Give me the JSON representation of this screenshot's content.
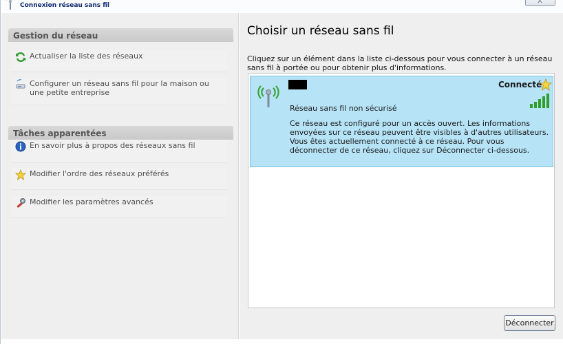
{
  "window": {
    "title": "Connexion réseau sans fil",
    "close_label": "X"
  },
  "sidebar": {
    "sections": [
      {
        "title": "Gestion du réseau",
        "items": [
          {
            "label": "Actualiser la liste des réseaux",
            "icon": "refresh-icon"
          },
          {
            "label": "Configurer un réseau sans fil pour la maison ou une petite entreprise",
            "icon": "setup-network-icon"
          }
        ]
      },
      {
        "title": "Tâches apparentées",
        "items": [
          {
            "label": "En savoir plus à propos des réseaux sans fil",
            "icon": "info-icon"
          },
          {
            "label": "Modifier l'ordre des réseaux préférés",
            "icon": "star-icon"
          },
          {
            "label": "Modifier les paramètres avancés",
            "icon": "settings-tools-icon"
          }
        ]
      }
    ]
  },
  "main": {
    "title": "Choisir un réseau sans fil",
    "instructions": "Cliquez sur un élément dans la liste ci-dessous pour vous connecter à un réseau sans fil à portée ou pour obtenir plus d'informations.",
    "networks": [
      {
        "status": "Connecté",
        "security": "Réseau sans fil non sécurisé",
        "signal_bars": 5,
        "description": "Ce réseau est configuré pour un accès ouvert. Les informations envoyées sur ce réseau peuvent être visibles à d'autres utilisateurs. Vous êtes actuellement connecté à ce réseau. Pour vous déconnecter de ce réseau, cliquez sur Déconnecter ci-dessous."
      }
    ],
    "disconnect_label": "Déconnecter"
  },
  "colors": {
    "selected_bg": "#b6e3f6",
    "signal_green": "#2f9e2f",
    "sidebar_bg": "#efefef"
  }
}
